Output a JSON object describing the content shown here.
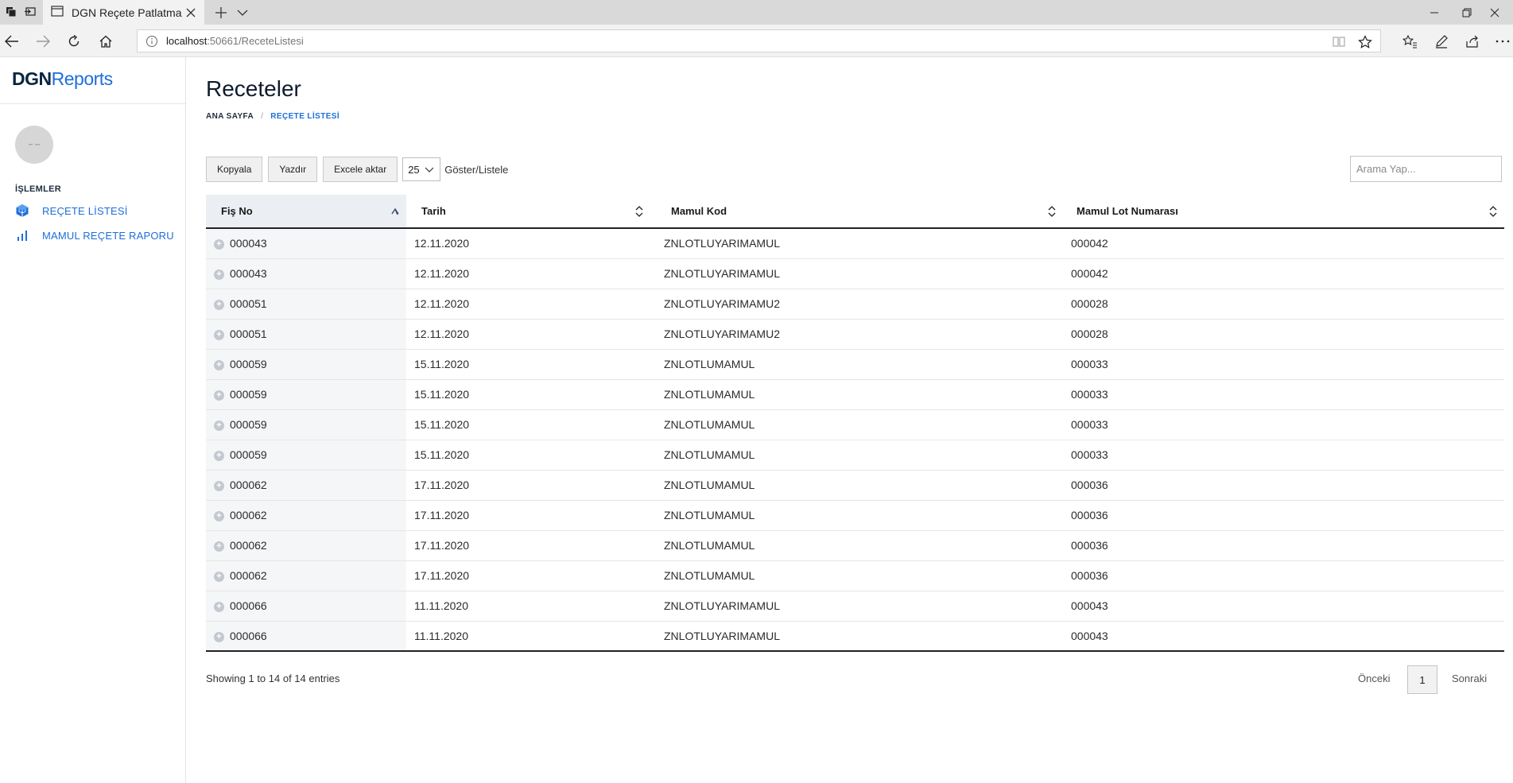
{
  "browser": {
    "tab_title": "DGN Reçete Patlatma",
    "url_host": "localhost",
    "url_path": ":50661/ReceteListesi"
  },
  "sidebar": {
    "brand_primary": "DGN",
    "brand_secondary": "Reports",
    "section_title": "İŞLEMLER",
    "items": [
      {
        "label": "REÇETE LİSTESİ",
        "icon": "cube-icon"
      },
      {
        "label": "MAMUL REÇETE RAPORU",
        "icon": "bar-chart-icon"
      }
    ]
  },
  "main": {
    "title": "Receteler",
    "breadcrumb": {
      "home": "ANA SAYFA",
      "separator": "/",
      "current": "REÇETE LİSTESİ"
    },
    "toolbar": {
      "copy_label": "Kopyala",
      "print_label": "Yazdır",
      "excel_label": "Excele aktar",
      "page_size": "25",
      "show_label": "Göster/Listele"
    },
    "search": {
      "placeholder": "Arama Yap..."
    },
    "table": {
      "columns": [
        "Fiş No",
        "Tarih",
        "Mamul Kod",
        "Mamul Lot Numarası"
      ],
      "rows": [
        [
          "000043",
          "12.11.2020",
          "ZNLOTLUYARIMAMUL",
          "000042"
        ],
        [
          "000043",
          "12.11.2020",
          "ZNLOTLUYARIMAMUL",
          "000042"
        ],
        [
          "000051",
          "12.11.2020",
          "ZNLOTLUYARIMAMU2",
          "000028"
        ],
        [
          "000051",
          "12.11.2020",
          "ZNLOTLUYARIMAMU2",
          "000028"
        ],
        [
          "000059",
          "15.11.2020",
          "ZNLOTLUMAMUL",
          "000033"
        ],
        [
          "000059",
          "15.11.2020",
          "ZNLOTLUMAMUL",
          "000033"
        ],
        [
          "000059",
          "15.11.2020",
          "ZNLOTLUMAMUL",
          "000033"
        ],
        [
          "000059",
          "15.11.2020",
          "ZNLOTLUMAMUL",
          "000033"
        ],
        [
          "000062",
          "17.11.2020",
          "ZNLOTLUMAMUL",
          "000036"
        ],
        [
          "000062",
          "17.11.2020",
          "ZNLOTLUMAMUL",
          "000036"
        ],
        [
          "000062",
          "17.11.2020",
          "ZNLOTLUMAMUL",
          "000036"
        ],
        [
          "000062",
          "17.11.2020",
          "ZNLOTLUMAMUL",
          "000036"
        ],
        [
          "000066",
          "11.11.2020",
          "ZNLOTLUYARIMAMUL",
          "000043"
        ],
        [
          "000066",
          "11.11.2020",
          "ZNLOTLUYARIMAMUL",
          "000043"
        ]
      ]
    },
    "info": "Showing 1 to 14 of 14 entries",
    "pagination": {
      "prev": "Önceki",
      "page": "1",
      "next": "Sonraki"
    }
  },
  "colors": {
    "accent": "#1e6fd9",
    "brand_dark": "#0a2540"
  }
}
